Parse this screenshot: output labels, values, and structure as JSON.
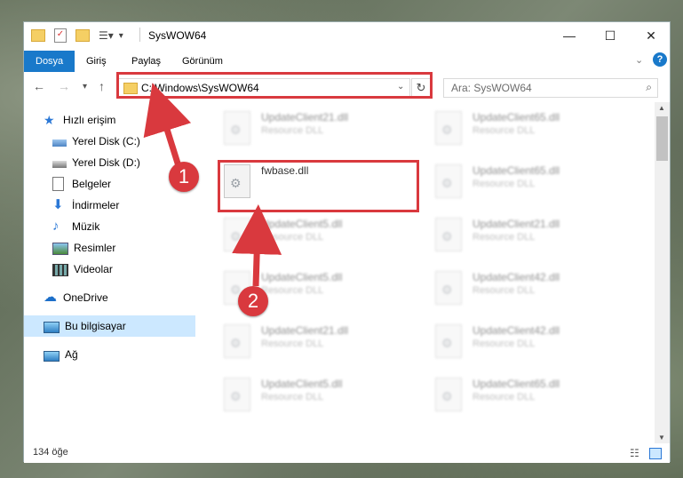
{
  "window": {
    "title": "SysWOW64",
    "controls": {
      "minimize": "—",
      "maximize": "☐",
      "close": "✕"
    }
  },
  "ribbon": {
    "tabs": [
      "Dosya",
      "Giriş",
      "Paylaş",
      "Görünüm"
    ]
  },
  "nav": {
    "address": "C:\\Windows\\SysWOW64",
    "search_placeholder": "Ara: SysWOW64"
  },
  "sidebar": {
    "items": [
      {
        "label": "Hızlı erişim",
        "icon": "star-icon"
      },
      {
        "label": "Yerel Disk (C:)",
        "icon": "disk-icon",
        "pinned": true
      },
      {
        "label": "Yerel Disk (D:)",
        "icon": "disk-icon",
        "pinned": true
      },
      {
        "label": "Belgeler",
        "icon": "document-icon",
        "pinned": true
      },
      {
        "label": "İndirmeler",
        "icon": "download-icon",
        "pinned": true
      },
      {
        "label": "Müzik",
        "icon": "music-icon",
        "pinned": true
      },
      {
        "label": "Resimler",
        "icon": "picture-icon",
        "pinned": true
      },
      {
        "label": "Videolar",
        "icon": "video-icon",
        "pinned": true
      },
      {
        "label": "OneDrive",
        "icon": "cloud-icon"
      },
      {
        "label": "Bu bilgisayar",
        "icon": "computer-icon",
        "selected": true
      },
      {
        "label": "Ağ",
        "icon": "network-icon"
      }
    ]
  },
  "files": {
    "left_column": [
      {
        "name": "UpdateClient21.dll",
        "desc": "Resource DLL"
      },
      {
        "name": "fwbase.dll",
        "desc": ""
      },
      {
        "name": "UpdateClient5.dll",
        "desc": "Resource DLL"
      },
      {
        "name": "UpdateClient5.dll",
        "desc": "Resource DLL"
      },
      {
        "name": "UpdateClient21.dll",
        "desc": "Resource DLL"
      },
      {
        "name": "UpdateClient5.dll",
        "desc": "Resource DLL"
      }
    ],
    "right_column": [
      {
        "name": "UpdateClient65.dll",
        "desc": "Resource DLL"
      },
      {
        "name": "UpdateClient65.dll",
        "desc": "Resource DLL"
      },
      {
        "name": "UpdateClient21.dll",
        "desc": "Resource DLL"
      },
      {
        "name": "UpdateClient42.dll",
        "desc": "Resource DLL"
      },
      {
        "name": "UpdateClient42.dll",
        "desc": "Resource DLL"
      },
      {
        "name": "UpdateClient65.dll",
        "desc": "Resource DLL"
      }
    ]
  },
  "status": {
    "count": "134 öğe"
  },
  "annotations": {
    "badge1": "1",
    "badge2": "2",
    "accent": "#d9393e"
  }
}
